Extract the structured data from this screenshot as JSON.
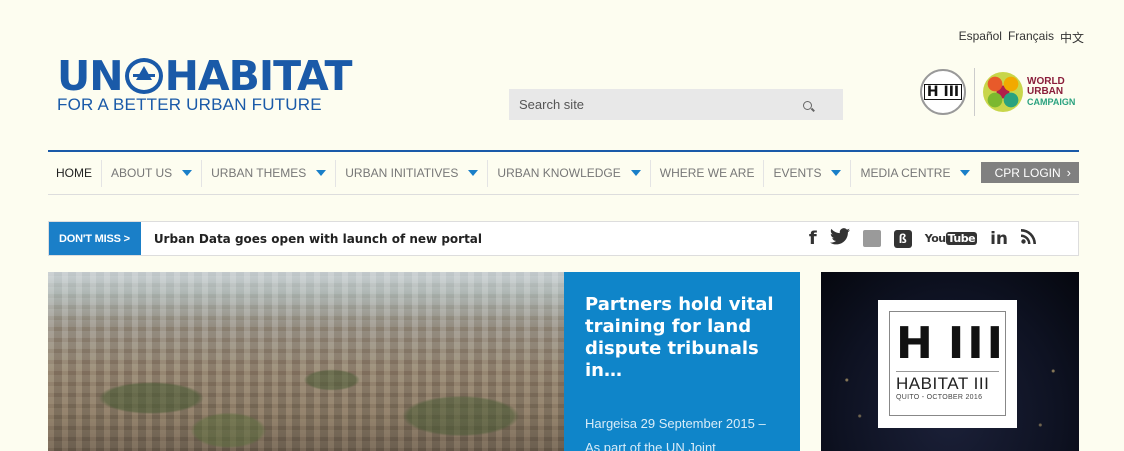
{
  "languages": [
    "Español",
    "Français",
    "中文"
  ],
  "logo": {
    "wordmark_left": "UN",
    "wordmark_right": "HABITAT",
    "tagline": "FOR A BETTER URBAN FUTURE"
  },
  "search": {
    "placeholder": "Search site"
  },
  "partners": {
    "habitat3_seal": "H III",
    "wuc_line1": "WORLD",
    "wuc_line2": "URBAN",
    "wuc_line3": "CAMPAIGN"
  },
  "nav": {
    "items": [
      {
        "label": "HOME",
        "dropdown": false
      },
      {
        "label": "ABOUT US",
        "dropdown": true
      },
      {
        "label": "URBAN THEMES",
        "dropdown": true
      },
      {
        "label": "URBAN INITIATIVES",
        "dropdown": true
      },
      {
        "label": "URBAN KNOWLEDGE",
        "dropdown": true
      },
      {
        "label": "WHERE WE ARE",
        "dropdown": false
      },
      {
        "label": "EVENTS",
        "dropdown": true
      },
      {
        "label": "MEDIA CENTRE",
        "dropdown": true
      }
    ],
    "cpr_login": "CPR LOGIN"
  },
  "dont_miss": {
    "label": "DON'T MISS >",
    "headline": "Urban Data goes open with launch of new portal"
  },
  "social": {
    "facebook": "f",
    "youtube_left": "You",
    "youtube_right": "Tube",
    "linkedin": "in"
  },
  "hero": {
    "title": "Partners hold vital training for land dispute tribunals in…",
    "excerpt": "Hargeisa 29 September 2015 – As part of the UN Joint"
  },
  "habitat3_banner": {
    "glyph_h": "H",
    "glyph_iii": "III",
    "name": "HABITAT III",
    "subtitle": "QUITO - OCTOBER 2016"
  },
  "colors": {
    "brand_blue": "#1a5aa8",
    "accent_blue": "#0f85c9",
    "page_background": "#fdfdf0"
  }
}
